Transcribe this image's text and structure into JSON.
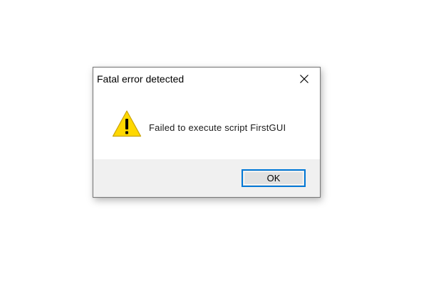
{
  "dialog": {
    "title": "Fatal error detected",
    "message": "Failed to execute script FirstGUI",
    "icon": "warning-icon",
    "ok_label": "OK"
  },
  "colors": {
    "accent": "#0078d7",
    "footer_bg": "#f0f0f0",
    "warning_fill": "#ffd800"
  }
}
